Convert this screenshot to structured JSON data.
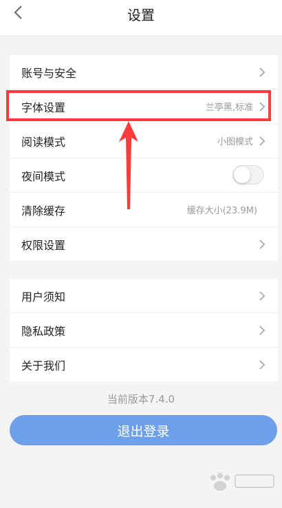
{
  "header": {
    "title": "设置",
    "back_icon": "chevron-left-icon"
  },
  "group1": {
    "items": [
      {
        "label": "账号与安全",
        "value": ""
      },
      {
        "label": "字体设置",
        "value": "兰亭黑,标准"
      },
      {
        "label": "阅读模式",
        "value": "小图模式"
      },
      {
        "label": "夜间模式",
        "toggle": false
      },
      {
        "label": "清除缓存",
        "value": "缓存大小(23.9M)"
      },
      {
        "label": "权限设置",
        "value": ""
      }
    ]
  },
  "group2": {
    "items": [
      {
        "label": "用户须知"
      },
      {
        "label": "隐私政策"
      },
      {
        "label": "关于我们"
      }
    ]
  },
  "footer": {
    "version": "当前版本7.4.0",
    "logout_label": "退出登录"
  },
  "colors": {
    "accent": "#6ea0ea",
    "highlight": "#ff3b3b",
    "background": "#f4f4f4"
  }
}
